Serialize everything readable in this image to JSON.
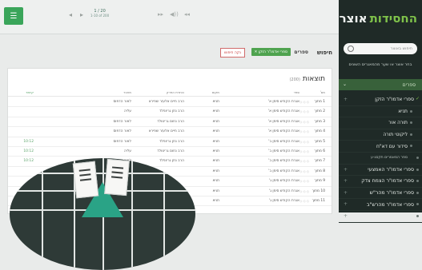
{
  "sidebar": {
    "title_main": "אוצר",
    "title_accent": "החסידות",
    "search_placeholder": "חיפוש באוצר",
    "subtitle": "בחר אוצר או שער מהמאגרים השונים",
    "category": "ספרים",
    "items": [
      {
        "label": "ספרי אדמו\"ר הזקן",
        "level": "top",
        "checked": true
      },
      {
        "label": "תניא",
        "level": "sub"
      },
      {
        "label": "תורה אור",
        "level": "sub"
      },
      {
        "label": "ליקוטי תורה",
        "level": "sub"
      },
      {
        "label": "סידור עם דא\"ח",
        "level": "sub"
      },
      {
        "label": "ספר המאמרים תקסג-ע",
        "level": "small"
      },
      {
        "label": "ספרי אדמו\"ר האמצעי",
        "level": "top"
      },
      {
        "label": "ספרי אדמו\"ר הצמח צדק",
        "level": "top"
      },
      {
        "label": "ספרי אדמו\"ר מהר\"ש",
        "level": "top"
      },
      {
        "label": "ספרי אדמו\"ר מהרש\"ב",
        "level": "top"
      },
      {
        "label": "ספרי אדמו\"ר מהריי\"צ",
        "level": "top"
      }
    ]
  },
  "toolbar": {
    "menu_icon": "menu-list-icon",
    "pager_top": "1-10 of 200",
    "pager_num": "1 / 20"
  },
  "search": {
    "label": "חיפוש",
    "label2": "ספרים",
    "tag_green": "ספרי אדמו\"ר הזקן ✕",
    "tag_red": "נקה חיפוש"
  },
  "results": {
    "title": "תוצאות",
    "count": "(200)",
    "headers": [
      "מס'",
      "ספר",
      "מקום",
      "כותרת הפרק",
      "מחבר",
      "קישור"
    ],
    "rows": [
      {
        "num": "1 מתוך",
        "book": "אגרת הקודש סימן א'",
        "loc": "תניא",
        "title": "הרב חיים אלעזר שפירא",
        "auth": "לאור הדפוס",
        "link": ""
      },
      {
        "num": "2 מתוך",
        "book": "אגרת הקודש סימן א'",
        "loc": "תניא",
        "title": "הרב נתן גרינפלד",
        "auth": "עליה",
        "link": ""
      },
      {
        "num": "3 מתוך",
        "book": "אגרת הקודש סימן א'",
        "loc": "תניא",
        "title": "הרב נחום גרינוולד",
        "auth": "לאור הדפוס",
        "link": ""
      },
      {
        "num": "4 מתוך",
        "book": "אגרת הקודש סימן א'",
        "loc": "תניא",
        "title": "הרב חיים אלעזר שפירא",
        "auth": "לאור הדפוס",
        "link": ""
      },
      {
        "num": "5 מתוך",
        "book": "אגרת הקודש סימן ב'",
        "loc": "תניא",
        "title": "הרב נתן גרינפלד",
        "auth": "לאור הדפוס",
        "link": "10:12"
      },
      {
        "num": "6 מתוך",
        "book": "אגרת הקודש סימן ב'",
        "loc": "תניא",
        "title": "הרב נחום גרינוולד",
        "auth": "עליה",
        "link": "10:12"
      },
      {
        "num": "7 מתוך",
        "book": "אגרת הקודש סימן ב'",
        "loc": "תניא",
        "title": "הרב נתן גרינפלד",
        "auth": "לאור הדפוס",
        "link": "10:12"
      },
      {
        "num": "8 מתוך",
        "book": "אגרת הקודש סימן ב'",
        "loc": "תניא",
        "title": "",
        "auth": "",
        "link": ""
      },
      {
        "num": "9 מתוך",
        "book": "אגרת הקודש סימן ג'",
        "loc": "תניא",
        "title": "",
        "auth": "",
        "link": ""
      },
      {
        "num": "10 מתוך",
        "book": "אגרת הקודש סימן ג'",
        "loc": "תניא",
        "title": "",
        "auth": "",
        "link": ""
      },
      {
        "num": "11 מתוך",
        "book": "אגרת הקודש סימן ג'",
        "loc": "תניא",
        "title": "",
        "auth": "",
        "link": ""
      }
    ]
  },
  "colors": {
    "sidebar_bg": "#1f2a27",
    "accent_green": "#3aa55a",
    "category_bg": "#38613a"
  }
}
